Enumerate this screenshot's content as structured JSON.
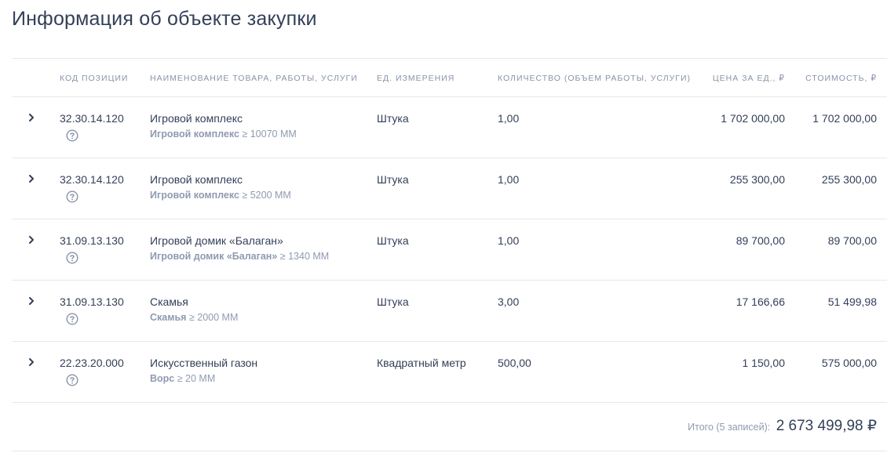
{
  "title": "Информация об объекте закупки",
  "columns": {
    "code": "Код позиции",
    "name": "Наименование товара, работы, услуги",
    "unit": "Ед. измерения",
    "qty": "Количество (объем работы, услуги)",
    "price": "Цена за ед., ₽",
    "cost": "Стоимость, ₽"
  },
  "rows": [
    {
      "code": "32.30.14.120",
      "name": "Игровой комплекс",
      "sub_bold": "Игровой комплекс",
      "sub_rest": " ≥ 10070 ММ",
      "unit": "Штука",
      "qty": "1,00",
      "price": "1 702 000,00",
      "cost": "1 702 000,00"
    },
    {
      "code": "32.30.14.120",
      "name": "Игровой комплекс",
      "sub_bold": "Игровой комплекс",
      "sub_rest": " ≥ 5200 ММ",
      "unit": "Штука",
      "qty": "1,00",
      "price": "255 300,00",
      "cost": "255 300,00"
    },
    {
      "code": "31.09.13.130",
      "name": "Игровой домик «Балаган»",
      "sub_bold": "Игровой домик «Балаган»",
      "sub_rest": " ≥ 1340 ММ",
      "unit": "Штука",
      "qty": "1,00",
      "price": "89 700,00",
      "cost": "89 700,00"
    },
    {
      "code": "31.09.13.130",
      "name": "Скамья",
      "sub_bold": "Скамья",
      "sub_rest": " ≥ 2000 ММ",
      "unit": "Штука",
      "qty": "3,00",
      "price": "17 166,66",
      "cost": "51 499,98"
    },
    {
      "code": "22.23.20.000",
      "name": "Искусственный газон",
      "sub_bold": "Ворс",
      "sub_rest": " ≥ 20 ММ",
      "unit": "Квадратный метр",
      "qty": "500,00",
      "price": "1 150,00",
      "cost": "575 000,00"
    }
  ],
  "total": {
    "label": "Итого (5 записей):",
    "value": "2 673 499,98 ₽"
  },
  "icons": {
    "expand": "chevron-right-icon",
    "help": "question-circle-icon"
  },
  "colors": {
    "text": "#334059",
    "muted": "#8893a8",
    "divider": "#e5e8ee"
  }
}
